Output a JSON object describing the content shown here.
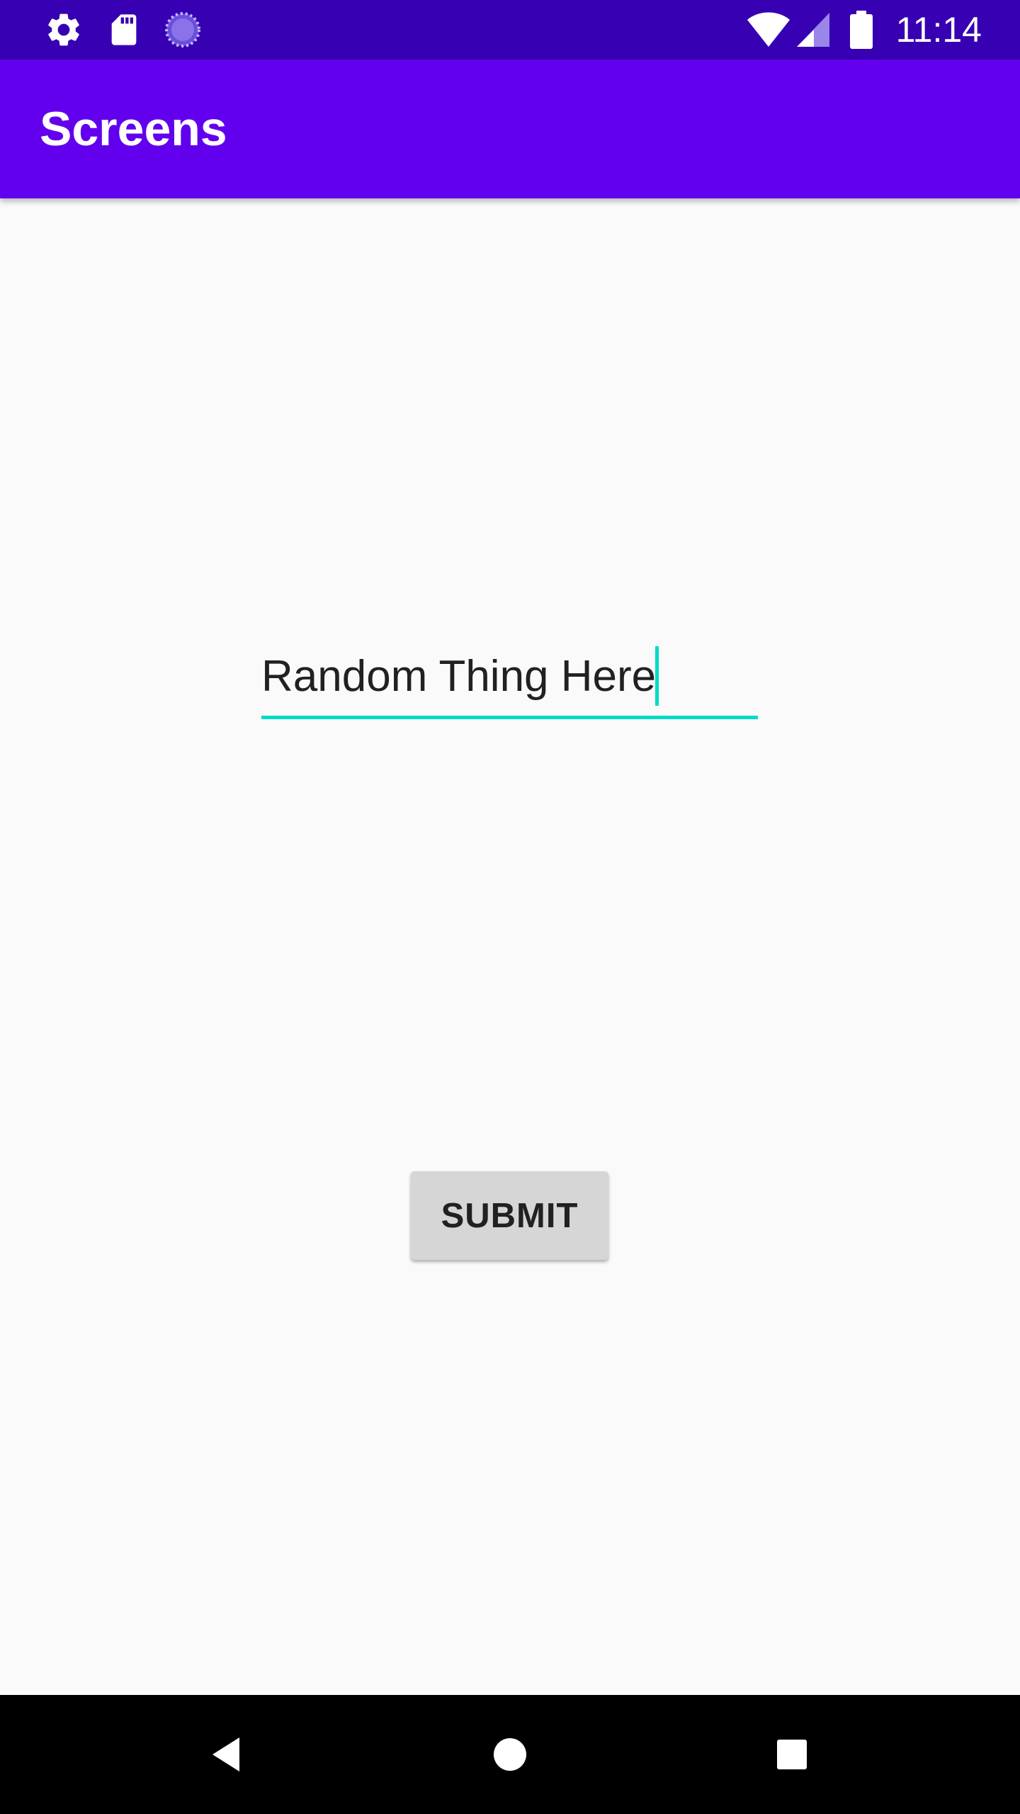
{
  "status_bar": {
    "time": "11:14",
    "icons": [
      "gear-icon",
      "sd-card-icon",
      "loading-icon",
      "wifi-icon",
      "signal-icon",
      "battery-icon"
    ]
  },
  "app_bar": {
    "title": "Screens"
  },
  "form": {
    "text_field_value": "Random Thing Here",
    "submit_label": "SUBMIT"
  },
  "nav_bar": {
    "icons": [
      "back-icon",
      "home-icon",
      "recents-icon"
    ]
  },
  "colors": {
    "status_bar": "#3700b3",
    "app_bar": "#6200ee",
    "accent": "#03dac5",
    "background": "#fafafa",
    "button": "#d6d6d6"
  }
}
